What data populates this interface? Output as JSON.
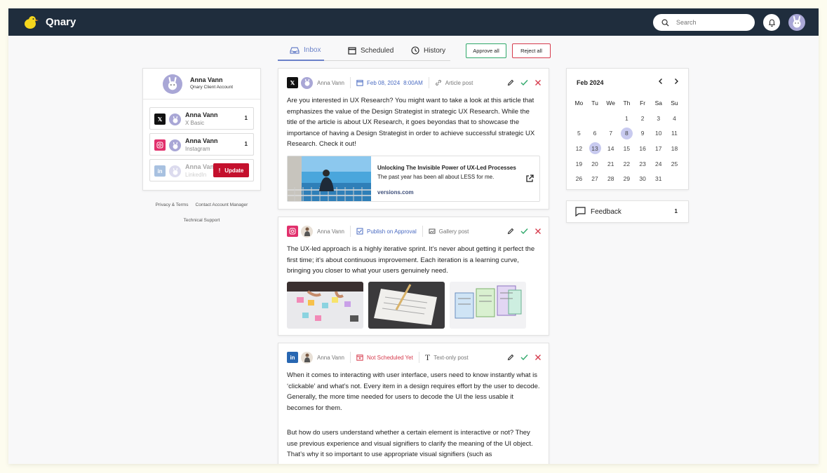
{
  "app": {
    "brand": "Qnary",
    "search_placeholder": "Search"
  },
  "tabs": [
    {
      "label": "Inbox",
      "icon": "inbox-icon",
      "active": true
    },
    {
      "label": "Scheduled",
      "icon": "calendar-icon"
    },
    {
      "label": "History",
      "icon": "clock-icon"
    }
  ],
  "bulk": {
    "approve_all": "Approve all",
    "reject_all": "Reject all"
  },
  "account": {
    "name": "Anna Vann",
    "subtitle": "Qnary Client Account",
    "rows": [
      {
        "name": "Anna Vann",
        "network": "X Basic",
        "count": "1"
      },
      {
        "name": "Anna Vann",
        "network": "Instagram",
        "count": "1"
      },
      {
        "name": "Anna Vann",
        "network": "LinkedIn",
        "update": "Update"
      }
    ]
  },
  "footer": {
    "privacy": "Privacy & Terms",
    "contact": "Contact Account Manager",
    "support": "Technical Support"
  },
  "posts": [
    {
      "network": "X",
      "author": "Anna Vann",
      "date": "Feb 08, 2024",
      "time": "8:00AM",
      "type": "Article post",
      "text": "Are you interested in UX Research? You might want to take a look at this article that emphasizes the value of the Design Strategist in strategic UX Research. While the title of the article is about UX Research, it goes beyondas that to showcase the importance of having a Design Strategist in order to achieve successful strategic UX Research. Check it out!",
      "link": {
        "title": "Unlocking The Invisible Power of UX-Led Processes",
        "desc": "The past year has been all about LESS for me.",
        "url": "versions.com"
      }
    },
    {
      "network": "Instagram",
      "author": "Anna Vann",
      "status": "Publish on Approval",
      "type": "Gallery post",
      "text": "The UX-led approach is a highly iterative sprint. It’s never about getting it perfect the first time; it’s about continuous improvement. Each iteration is a learning curve, bringing you closer to what your users genuinely need."
    },
    {
      "network": "LinkedIn",
      "author": "Anna Vann",
      "status": "Not Scheduled Yet",
      "type": "Text-only post",
      "text": "When it comes to interacting with user interface, users need to know instantly what is ‘clickable’ and what’s not. Every item in a design requires effort by the user to decode. Generally, the more time needed for users to decode the UI the less usable it becomes for them.",
      "text2": "But how do users understand whether a certain element is interactive or not? They use previous experience and visual signifiers to clarify the meaning of the UI object. That’s why it so important to use appropriate visual signifiers (such as"
    }
  ],
  "calendar": {
    "title": "Feb 2024",
    "weekdays": [
      "Mo",
      "Tu",
      "We",
      "Th",
      "Fr",
      "Sa",
      "Su"
    ],
    "days": [
      "",
      "",
      "",
      "1",
      "2",
      "3",
      "4",
      "5",
      "6",
      "7",
      "8",
      "9",
      "10",
      "11",
      "12",
      "13",
      "14",
      "15",
      "16",
      "17",
      "18",
      "19",
      "20",
      "21",
      "22",
      "23",
      "24",
      "25",
      "26",
      "27",
      "28",
      "29",
      "30",
      "31",
      ""
    ],
    "highlighted": [
      "8",
      "13"
    ]
  },
  "feedback": {
    "label": "Feedback",
    "count": "1"
  },
  "colors": {
    "topbar": "#1f2d3d",
    "accent": "#6b82c9",
    "approve": "#2fa86a",
    "reject": "#d63a4c",
    "instagram": "#e1306c",
    "linkedin": "#2867b2"
  }
}
